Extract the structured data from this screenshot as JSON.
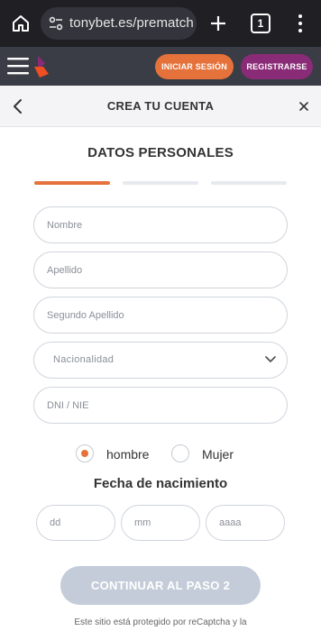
{
  "browser": {
    "url": "tonybet.es/prematch",
    "tab_count": "1",
    "icons": [
      "home-icon",
      "site-settings-icon",
      "plus-icon",
      "tabs-icon",
      "more-vert-icon"
    ]
  },
  "site_header": {
    "login_label": "INICIAR SESIÓN",
    "register_label": "REGISTRARSE",
    "colors": {
      "header_bg": "#3a3d46",
      "login": "#e5723b",
      "register": "#8a2b77"
    }
  },
  "modal": {
    "title": "CREA TU CUENTA",
    "section_title": "DATOS PERSONALES",
    "progress_steps": [
      {
        "step": 1,
        "state": "active",
        "color": "#e5723b"
      },
      {
        "step": 2,
        "state": "inactive",
        "color": "#e6e9ee"
      },
      {
        "step": 3,
        "state": "inactive",
        "color": "#e6e9ee"
      }
    ]
  },
  "form": {
    "nombre_placeholder": "Nombre",
    "apellido_placeholder": "Apellido",
    "segundo_apellido_placeholder": "Segundo Apellido",
    "nacionalidad_label": "Nacionalidad",
    "dni_placeholder": "DNI / NIE",
    "gender": {
      "options": [
        "hombre",
        "Mujer"
      ],
      "selected": "hombre"
    },
    "dob_title": "Fecha de nacimiento",
    "dob_day_placeholder": "dd",
    "dob_month_placeholder": "mm",
    "dob_year_placeholder": "aaaa",
    "continue_label": "CONTINUAR AL PASO 2"
  },
  "footer_note": "Este sitio está protegido por reCaptcha y la"
}
